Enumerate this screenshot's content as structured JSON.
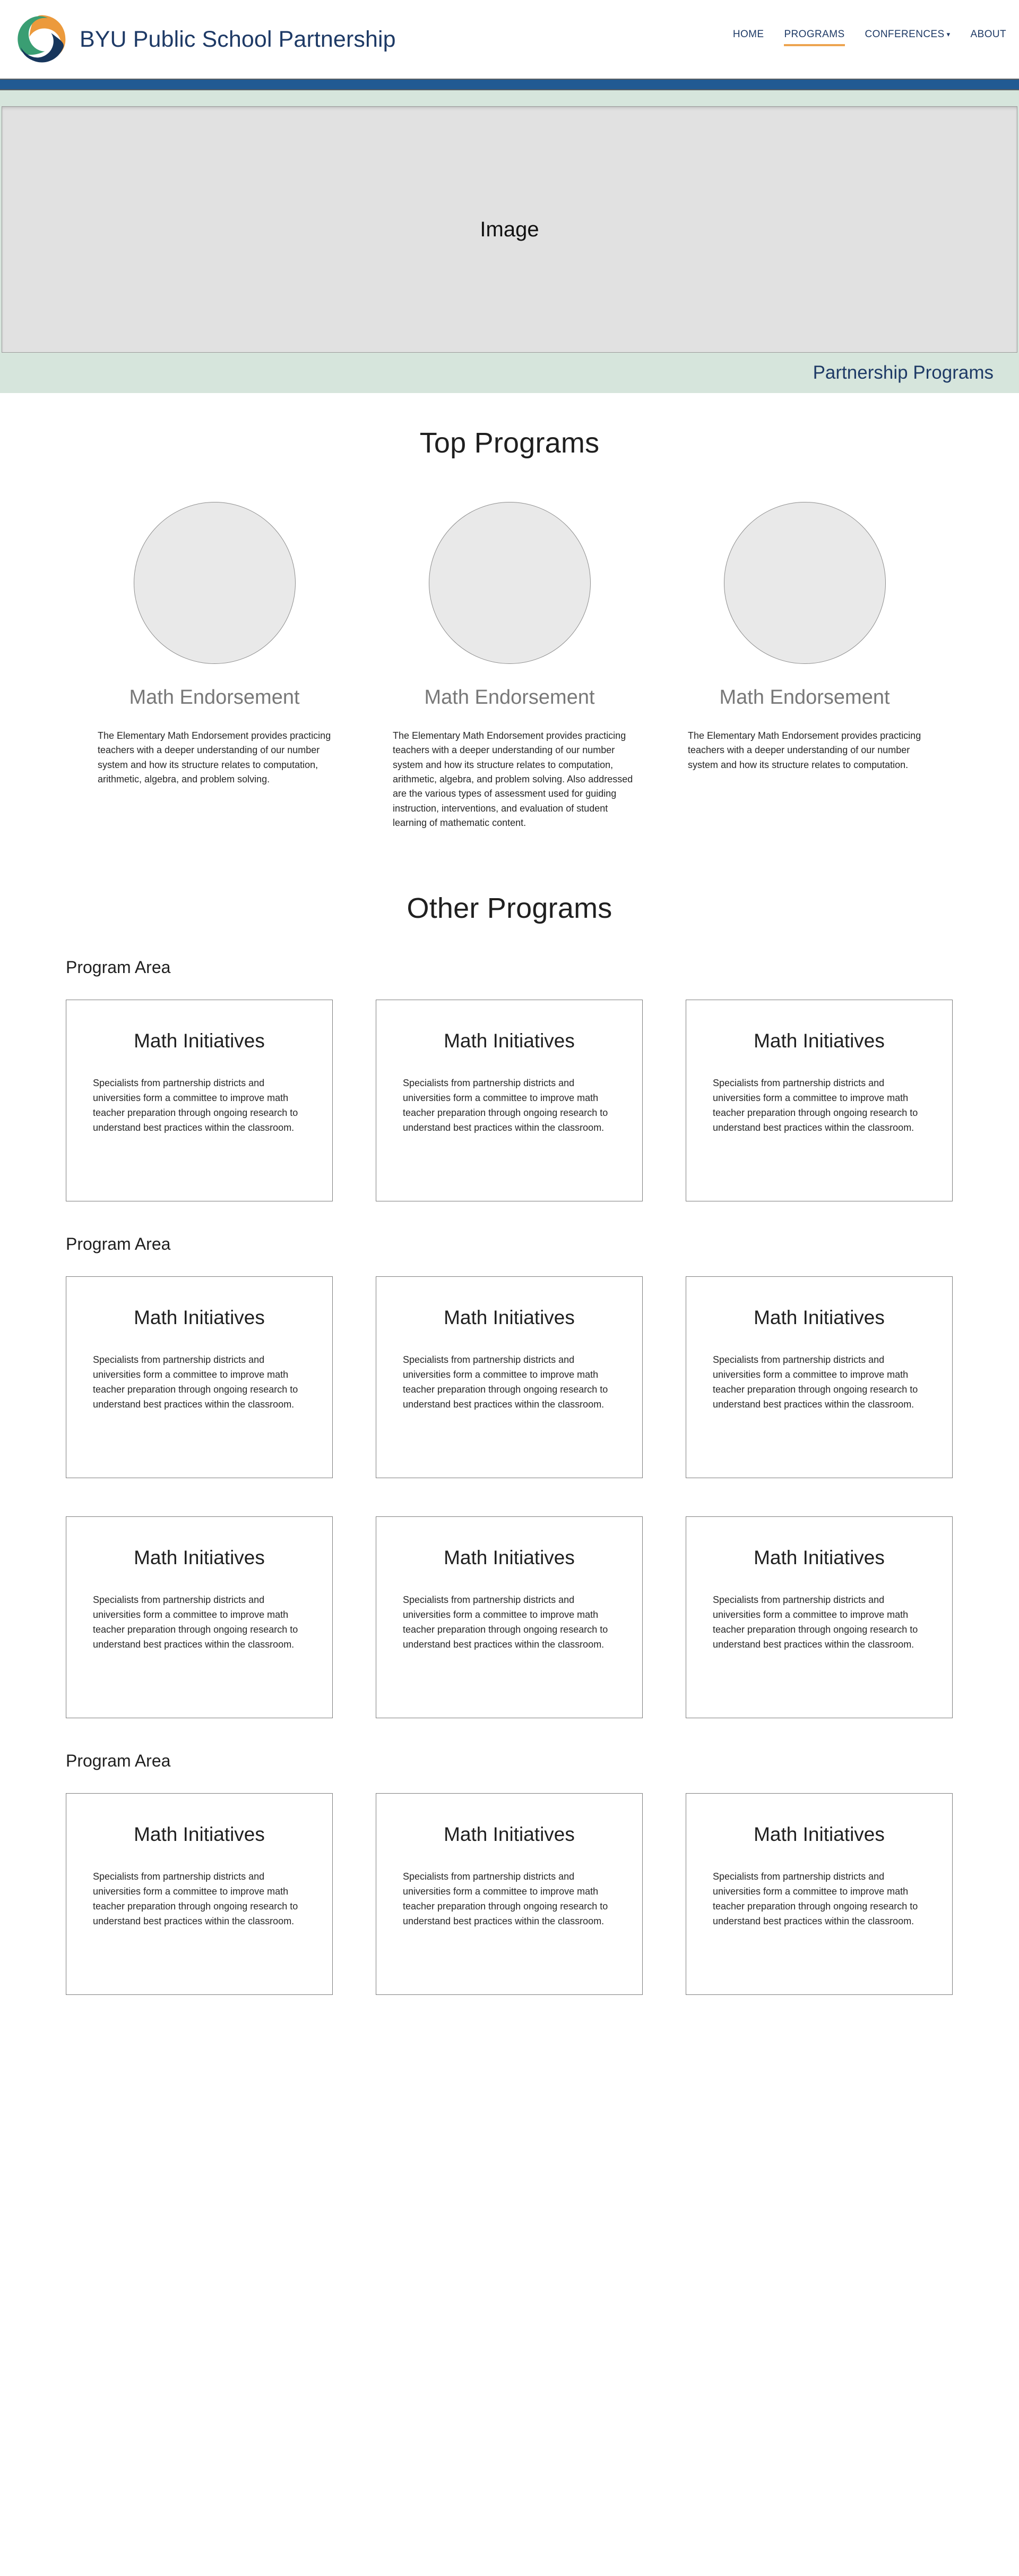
{
  "header": {
    "brand_title": "BYU Public School Partnership",
    "logo_colors": {
      "orange": "#ec9a3c",
      "green": "#3a9e73",
      "navy": "#17365c"
    },
    "nav": [
      {
        "label": "HOME",
        "active": false,
        "has_caret": false
      },
      {
        "label": "PROGRAMS",
        "active": true,
        "has_caret": false
      },
      {
        "label": "CONFERENCES",
        "active": false,
        "has_caret": true,
        "caret": "▾"
      },
      {
        "label": "ABOUT",
        "active": false,
        "has_caret": false
      }
    ],
    "accent_color": "#eda450",
    "link_color": "#1e3a66"
  },
  "accent_bar": {
    "color": "#215a93"
  },
  "hero": {
    "background_color": "#d6e5dc",
    "image_placeholder_label": "Image",
    "caption": "Partnership Programs"
  },
  "top_programs": {
    "heading": "Top Programs",
    "cards": [
      {
        "title": "Math Endorsement",
        "body": "The Elementary Math Endorsement provides practicing teachers with a deeper understanding of our number system and how its structure relates to computation, arithmetic, algebra, and problem solving."
      },
      {
        "title": "Math Endorsement",
        "body": "The Elementary Math Endorsement provides practicing teachers with a deeper understanding of our number system and how its structure relates to computation, arithmetic, algebra, and problem solving. Also addressed are the various types of assessment used for guiding instruction, interventions, and evaluation of student learning of mathematic content."
      },
      {
        "title": "Math Endorsement",
        "body": "The Elementary Math Endorsement provides practicing teachers with a deeper understanding of our number system and how its structure relates to computation."
      }
    ]
  },
  "other_programs": {
    "heading": "Other Programs",
    "areas": [
      {
        "label": "Program Area",
        "cards": [
          {
            "title": "Math Initiatives",
            "body": "Specialists from partnership districts and universities form a committee to improve math teacher preparation through ongoing research to understand best practices within the classroom."
          },
          {
            "title": "Math Initiatives",
            "body": "Specialists from partnership districts and universities form a committee to improve math teacher preparation through ongoing research to understand best practices within the classroom."
          },
          {
            "title": "Math Initiatives",
            "body": "Specialists from partnership districts and universities form a committee to improve math teacher preparation through ongoing research to understand best practices within the classroom."
          }
        ]
      },
      {
        "label": "Program Area",
        "cards": [
          {
            "title": "Math Initiatives",
            "body": "Specialists from partnership districts and universities form a committee to improve math teacher preparation through ongoing research to understand best practices within the classroom."
          },
          {
            "title": "Math Initiatives",
            "body": "Specialists from partnership districts and universities form a committee to improve math teacher preparation through ongoing research to understand best practices within the classroom."
          },
          {
            "title": "Math Initiatives",
            "body": "Specialists from partnership districts and universities form a committee to improve math teacher preparation through ongoing research to understand best practices within the classroom."
          },
          {
            "title": "Math Initiatives",
            "body": "Specialists from partnership districts and universities form a committee to improve math teacher preparation through ongoing research to understand best practices within the classroom."
          },
          {
            "title": "Math Initiatives",
            "body": "Specialists from partnership districts and universities form a committee to improve math teacher preparation through ongoing research to understand best practices within the classroom."
          },
          {
            "title": "Math Initiatives",
            "body": "Specialists from partnership districts and universities form a committee to improve math teacher preparation through ongoing research to understand best practices within the classroom."
          }
        ]
      },
      {
        "label": "Program Area",
        "cards": [
          {
            "title": "Math Initiatives",
            "body": "Specialists from partnership districts and universities form a committee to improve math teacher preparation through ongoing research to understand best practices within the classroom."
          },
          {
            "title": "Math Initiatives",
            "body": "Specialists from partnership districts and universities form a committee to improve math teacher preparation through ongoing research to understand best practices within the classroom."
          },
          {
            "title": "Math Initiatives",
            "body": "Specialists from partnership districts and universities form a committee to improve math teacher preparation through ongoing research to understand best practices within the classroom."
          }
        ]
      }
    ]
  }
}
